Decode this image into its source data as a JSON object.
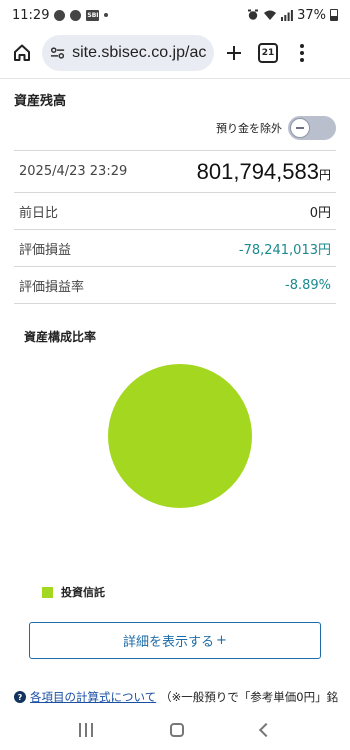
{
  "status_bar": {
    "time": "11:29",
    "app_badge": "SBI",
    "battery": "37%"
  },
  "browser": {
    "url": "site.sbisec.co.jp/acc",
    "tab_count": "21"
  },
  "page": {
    "section_title": "資産残高",
    "toggle_label": "預り金を除外",
    "summary": {
      "datetime": "2025/4/23 23:29",
      "total": "801,794,583",
      "total_unit": "円"
    },
    "rows": [
      {
        "label": "前日比",
        "value": "0円"
      },
      {
        "label": "評価損益",
        "value": "-78,241,013円"
      },
      {
        "label": "評価損益率",
        "value": "-8.89%"
      }
    ],
    "composition_title": "資産構成比率",
    "detail_button": "詳細を表示する",
    "detail_button_icon": "+",
    "note_link": "各項目の計算式について",
    "note_text": "（※一般預りで「参考単価0円」銘"
  },
  "chart_data": {
    "type": "pie",
    "labels": [
      "投資信託"
    ],
    "values": [
      100
    ],
    "colors": [
      "#a3d720"
    ]
  }
}
